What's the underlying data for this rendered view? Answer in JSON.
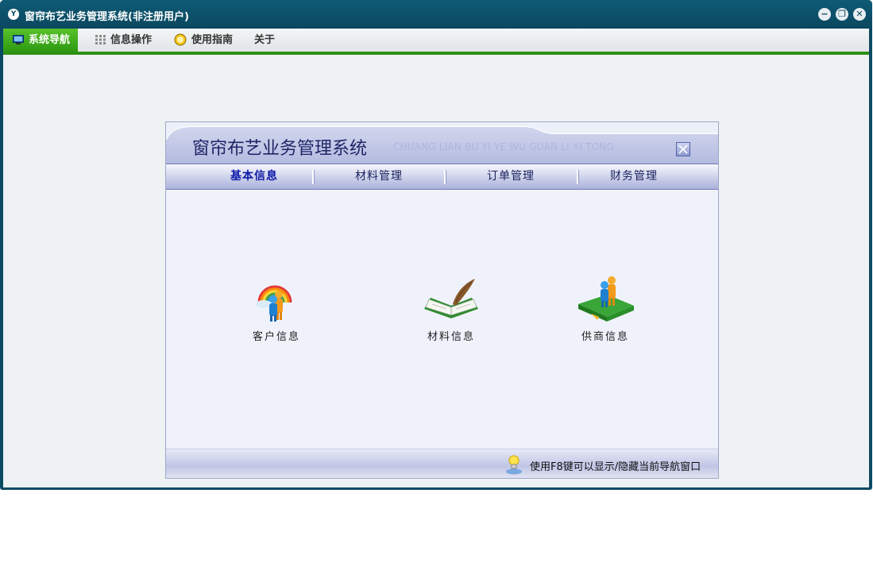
{
  "window": {
    "title": "窗帘布艺业务管理系统(非注册用户)",
    "logo_text": "Y",
    "controls": {
      "minimize": "−",
      "restore": "❐",
      "close": "✕"
    }
  },
  "menubar": {
    "items": [
      {
        "label": "系统导航",
        "icon": "monitor-icon",
        "active": true
      },
      {
        "label": "信息操作",
        "icon": "grid-icon",
        "active": false
      },
      {
        "label": "使用指南",
        "icon": "help-icon",
        "active": false
      },
      {
        "label": "关于",
        "icon": "",
        "active": false
      }
    ]
  },
  "dialog": {
    "title": "窗帘布艺业务管理系统",
    "subtitle": "CHUANG LIAN BU YI YE WU GUAN LI XI TONG",
    "tabs": [
      {
        "label": "基本信息",
        "active": true
      },
      {
        "label": "材料管理",
        "active": false
      },
      {
        "label": "订单管理",
        "active": false
      },
      {
        "label": "财务管理",
        "active": false
      }
    ],
    "tiles": [
      {
        "label": "客户信息",
        "icon": "customer-icon"
      },
      {
        "label": "材料信息",
        "icon": "material-book-icon"
      },
      {
        "label": "供商信息",
        "icon": "supplier-icon"
      }
    ],
    "footer_hint": "使用F8键可以显示/隐藏当前导航窗口"
  },
  "colors": {
    "title_bar": "#0b4a63",
    "menu_active": "#3fab1c",
    "menu_underline": "#2f8f13",
    "dialog_header": "#b4bbe0",
    "dialog_title": "#1e2566"
  }
}
